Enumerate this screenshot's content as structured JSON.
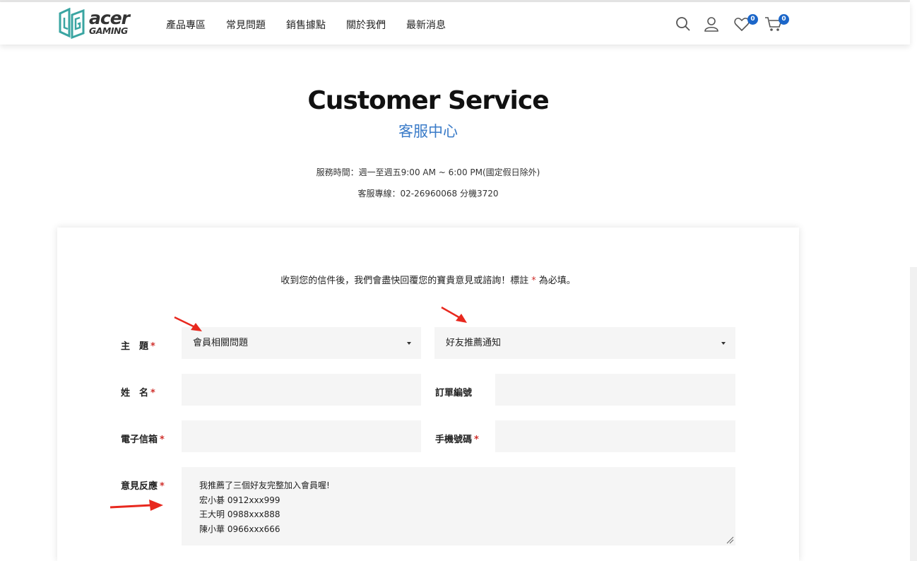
{
  "brand": {
    "line1": "acer",
    "line2": "GAMING"
  },
  "nav": [
    "產品專區",
    "常見問題",
    "銷售據點",
    "關於我們",
    "最新消息"
  ],
  "header_icons": {
    "search": "search-icon",
    "account": "user-icon",
    "wishlist": {
      "icon": "heart-icon",
      "count": "0"
    },
    "cart": {
      "icon": "cart-icon",
      "count": "0"
    }
  },
  "page": {
    "title_en": "Customer Service",
    "title_zh": "客服中心",
    "service_hours": "服務時間：週一至週五9:00 AM ~ 6:00 PM(國定假日除外)",
    "hotline": "客服專線：02-26960068 分機3720"
  },
  "form": {
    "notice_before": "收到您的信件後，我們會盡快回覆您的寶貴意見或諮詢！標註",
    "notice_star": "*",
    "notice_after": "為必填。",
    "required_mark": "*",
    "subject_label": "主　題",
    "subject_value": "會員相關問題",
    "subject_sub_value": "好友推薦通知",
    "name_label": "姓　名",
    "order_label": "訂單編號",
    "email_label": "電子信箱",
    "phone_label": "手機號碼",
    "feedback_label": "意見反應",
    "feedback_lines": [
      "我推薦了三個好友完整加入會員喔!",
      "宏小碁  0912xxx999",
      "王大明  0988xxx888",
      "陳小華  0966xxx666"
    ]
  },
  "colors": {
    "accent": "#3a7bc8",
    "badge": "#1b66c9",
    "required": "#d0312d",
    "annotation": "#e8281e"
  }
}
